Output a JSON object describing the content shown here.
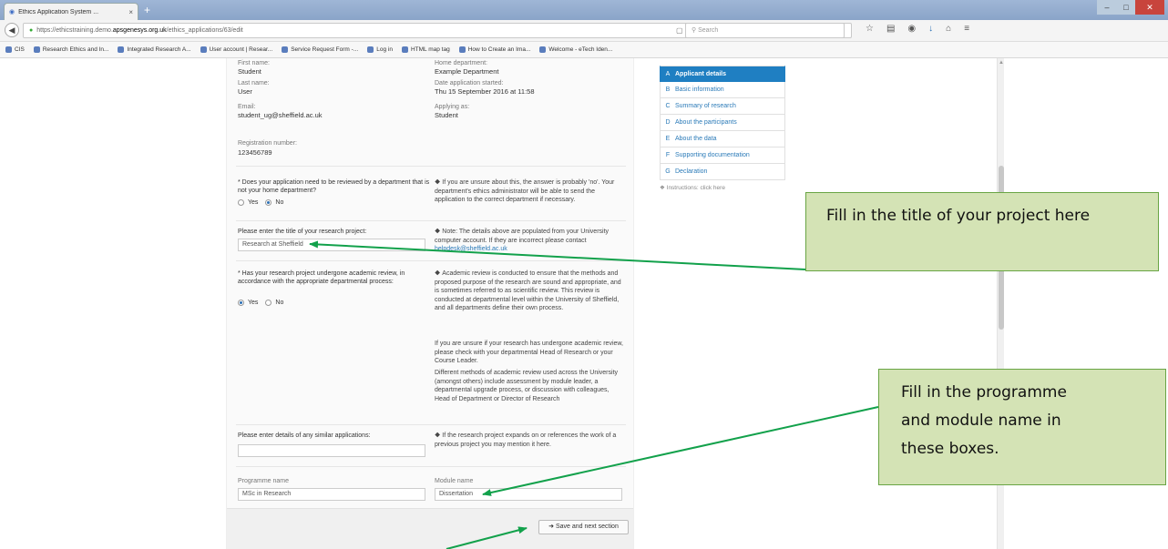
{
  "browser": {
    "tab_title": "Ethics Application System ...",
    "tab_close": "×",
    "new_tab": "+",
    "url_prefix": "https://ethicstraining.demo.",
    "url_domain": "apsgenesys.org.uk",
    "url_path": "/ethics_applications/63/edit",
    "search_placeholder": "Search",
    "bookmarks": [
      "CIS",
      "Research Ethics and In...",
      "Integrated Research A...",
      "User account | Resear...",
      "Service Request Form -...",
      "Log in",
      "HTML map tag",
      "How to Create an Ima...",
      "Welcome - eTech Iden..."
    ]
  },
  "form": {
    "first_name_label": "First name:",
    "first_name": "Student",
    "home_department_label": "Home department:",
    "home_department": "Example Department",
    "last_name_label": "Last name:",
    "last_name": "User",
    "date_started_label": "Date application started:",
    "date_started": "Thu 15 September 2016 at 11:58",
    "email_label": "Email:",
    "email": "student_ug@sheffield.ac.uk",
    "applying_as_label": "Applying as:",
    "applying_as": "Student",
    "registration_label": "Registration number:",
    "registration": "123456789",
    "q_other_dept": "* Does your application need to be reviewed by a department that is not your home department?",
    "info_other_dept": "If you are unsure about this, the answer is probably 'no'. Your department's ethics administrator will be able to send the application to the correct department if necessary.",
    "yes": "Yes",
    "no": "No",
    "title_label": "Please enter the title of your research project:",
    "title_value": "Research at Sheffield",
    "info_note_prefix": "Note: The details above are populated from your University computer account. If they are incorrect please contact",
    "info_note_email": "helpdesk@sheffield.ac.uk",
    "q_academic_review": "* Has your research project undergone academic review, in accordance with the appropriate departmental process:",
    "info_review_1": "Academic review is conducted to ensure that the methods and proposed purpose of the research are sound and appropriate, and is sometimes referred to as scientific review. This review is conducted at departmental level within the University of Sheffield, and all departments define their own process.",
    "info_review_2": "If you are unsure if your research has undergone academic review, please check with your departmental Head of Research or your Course Leader.",
    "info_review_3": "Different methods of academic review used across the University (amongst others) include assessment by module leader, a departmental upgrade process, or discussion with colleagues, Head of Department or Director of Research",
    "similar_label": "Please enter details of any similar applications:",
    "info_similar": "If the research project expands on or references the work of a previous project you may mention it here.",
    "programme_label": "Programme name",
    "programme_value": "MSc in Research",
    "module_label": "Module name",
    "module_value": "Dissertation",
    "save_button": "Save and next section"
  },
  "sidebar": {
    "items": [
      {
        "letter": "A",
        "label": "Applicant details"
      },
      {
        "letter": "B",
        "label": "Basic information"
      },
      {
        "letter": "C",
        "label": "Summary of research"
      },
      {
        "letter": "D",
        "label": "About the participants"
      },
      {
        "letter": "E",
        "label": "About the data"
      },
      {
        "letter": "F",
        "label": "Supporting documentation"
      },
      {
        "letter": "G",
        "label": "Declaration"
      }
    ],
    "instructions": "Instructions: click here"
  },
  "callouts": {
    "title": "Fill in the title of your project here",
    "programme_line1": "Fill in the programme",
    "programme_line2": "and module name in",
    "programme_line3": "these boxes."
  },
  "colors": {
    "callout_fill": "#d4e3b5",
    "callout_border": "#69a544",
    "arrow": "#12a14b",
    "active_nav": "#1f7fc2"
  }
}
